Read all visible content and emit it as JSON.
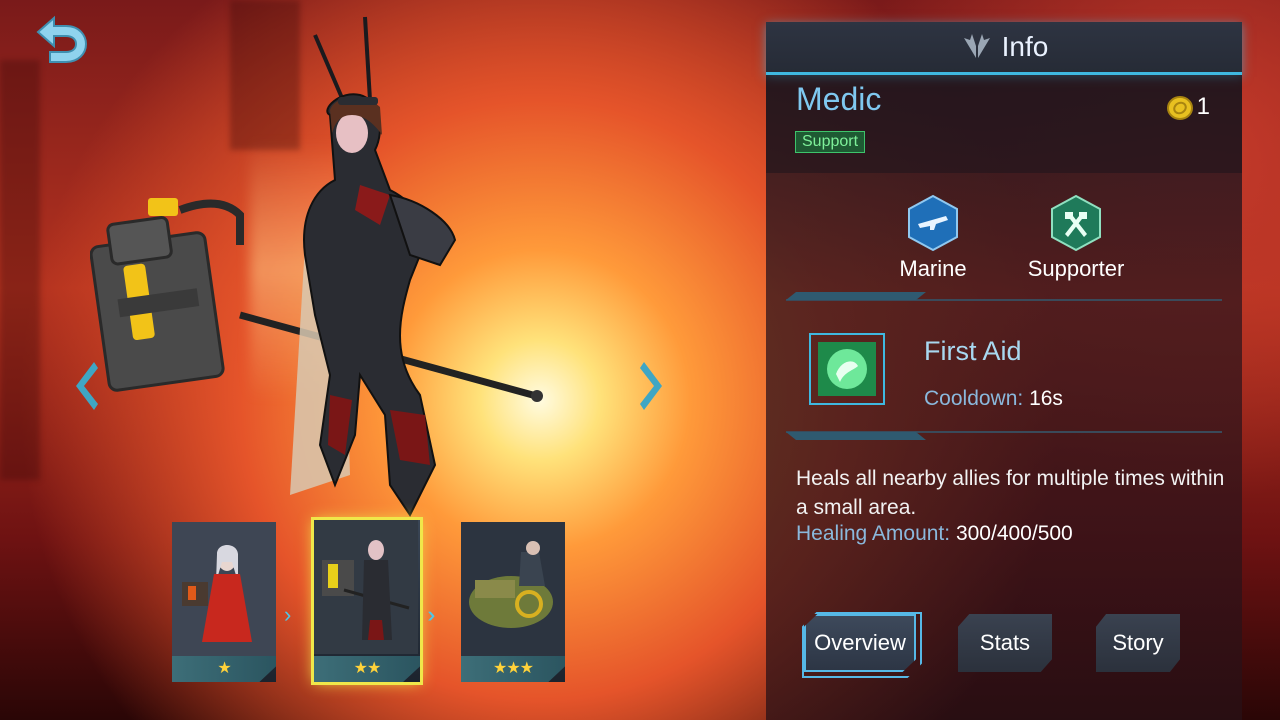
{
  "panel": {
    "title": "Info",
    "title_icon": "wings-icon"
  },
  "hero": {
    "name": "Medic",
    "role": "Support",
    "cost": "1",
    "cost_icon": "coin-icon"
  },
  "classes": [
    {
      "label": "Marine",
      "icon": "rifle-icon",
      "color": "#1f6fb8"
    },
    {
      "label": "Supporter",
      "icon": "crossed-hammers-icon",
      "color": "#1f7a5a"
    }
  ],
  "skill": {
    "name": "First Aid",
    "cooldown_label": "Cooldown:",
    "cooldown_value": "16s",
    "description": "Heals all nearby allies for multiple times within a small area.",
    "healing_label": "Healing Amount:",
    "healing_value": "300/400/500"
  },
  "tabs": {
    "overview": "Overview",
    "stats": "Stats",
    "story": "Story",
    "selected": "Overview"
  },
  "skins": [
    {
      "stars": "★",
      "rank": 1
    },
    {
      "stars": "★★",
      "rank": 2,
      "selected": true
    },
    {
      "stars": "★★★",
      "rank": 3
    }
  ],
  "colors": {
    "accent": "#3fb8e0",
    "hero_name": "#7fc8f0",
    "role_badge": "#3ec46b",
    "selected_skin": "#f0e74a",
    "star": "#ffd23a"
  }
}
